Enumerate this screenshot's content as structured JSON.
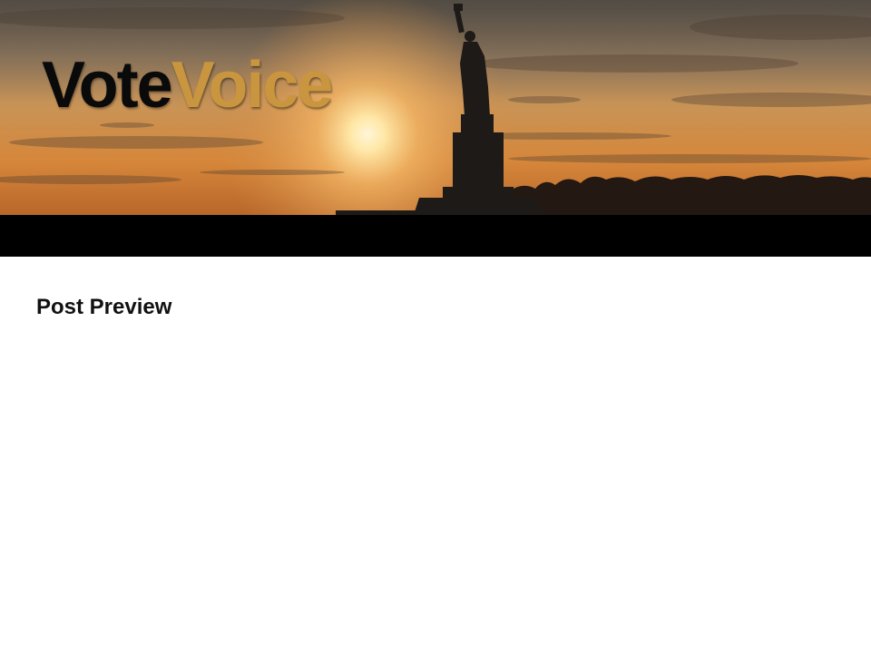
{
  "header": {
    "logo": {
      "word_dark": "Vote",
      "word_gold": "Voice",
      "color_dark": "#0a0a0a",
      "color_gold": "#c9963f"
    },
    "banner_image": "statue-of-liberty-sunset"
  },
  "navbar": {
    "background": "#000000"
  },
  "main": {
    "title": "Post Preview"
  }
}
